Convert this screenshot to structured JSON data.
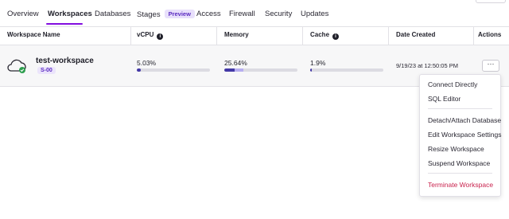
{
  "tabs": [
    {
      "label": "Overview"
    },
    {
      "label": "Workspaces"
    },
    {
      "label": "Databases"
    },
    {
      "label": "Stages",
      "badge": "Preview"
    },
    {
      "label": "Access"
    },
    {
      "label": "Firewall"
    },
    {
      "label": "Security"
    },
    {
      "label": "Updates"
    }
  ],
  "table": {
    "headers": {
      "name": "Workspace Name",
      "vcpu": "vCPU",
      "memory": "Memory",
      "cache": "Cache",
      "date": "Date Created",
      "actions": "Actions"
    }
  },
  "row": {
    "name": "test-workspace",
    "size": "S-00",
    "vcpu": "5.03%",
    "vcpu_fraction": 0.0503,
    "memory": "25.64%",
    "memory_fraction": 0.2564,
    "cache": "1.9%",
    "cache_fraction": 0.019,
    "date": "9/19/23 at 12:50:05 PM",
    "actions_label": "···",
    "status": "running"
  },
  "menu": {
    "items": [
      "Connect Directly",
      "SQL Editor",
      "Detach/Attach Database",
      "Edit Workspace Settings",
      "Resize Workspace",
      "Suspend Workspace",
      "Terminate Workspace"
    ]
  },
  "colors": {
    "accent": "#820ddf",
    "bar_fill": "#4338a6",
    "danger": "#c9224d",
    "status_ok": "#2e9e4f"
  }
}
